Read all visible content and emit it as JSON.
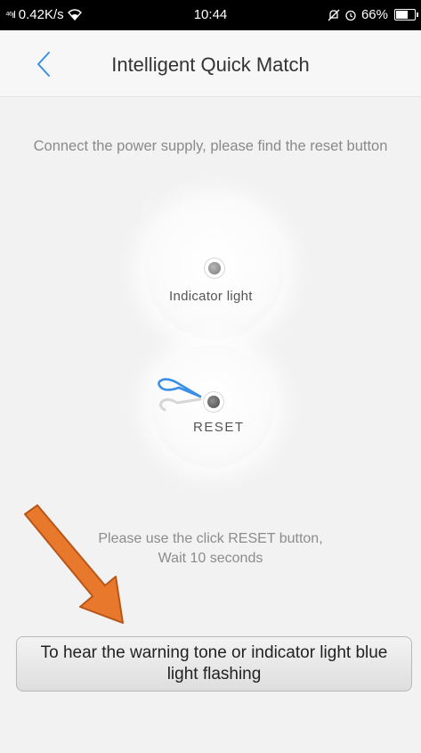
{
  "status_bar": {
    "network": "0.42K/s",
    "time": "10:44",
    "battery": "66%",
    "icons": [
      "signal-icon",
      "wifi-icon",
      "mute-icon",
      "alarm-icon",
      "battery-icon"
    ]
  },
  "nav": {
    "title": "Intelligent Quick Match",
    "back_icon": "chevron-left-icon"
  },
  "instruction": "Connect the power supply, please find the reset button",
  "device": {
    "indicator_label": "Indicator light",
    "reset_label": "RESET"
  },
  "hint": {
    "line1": "Please use the click RESET button,",
    "line2": "Wait 10 seconds"
  },
  "confirm_button": {
    "label": "To hear the warning tone or indicator light blue light flashing"
  },
  "colors": {
    "accent": "#3a8ee6",
    "arrow": "#e8782b",
    "background": "#f2f2f2"
  }
}
